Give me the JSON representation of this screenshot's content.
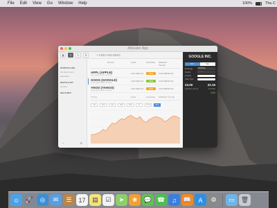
{
  "menubar": {
    "apple": "",
    "items": [
      "File",
      "Edit",
      "View",
      "Go",
      "Window",
      "Help"
    ],
    "battery": "100%",
    "clock": "Thu C"
  },
  "window": {
    "title": "Allocator App",
    "add_label": "+ ADD HOLDING",
    "sidebar": {
      "sections": [
        {
          "head": "PORTFOLIOS",
          "items": [
            "My Retirement",
            "Education"
          ]
        },
        {
          "head": "WATCHLIST",
          "items": [
            "Growth"
          ]
        },
        {
          "head": "SECTORS",
          "items": []
        }
      ],
      "footer": [
        "+",
        "⚙"
      ]
    },
    "table": {
      "headers": [
        "STOCK",
        "GAIN",
        "CHANGE",
        "MARKET VALUE"
      ],
      "rows": [
        {
          "name": "APPL (APPLE)",
          "sub": "Lorem ipsum dolor sit amet",
          "gain": "CAD $300.00",
          "change": "15%",
          "value": "CAD $38000.00",
          "color": "#f5a623"
        },
        {
          "name": "GOOG (GOOGLE)",
          "sub": "Lorem ipsum dolor sit amet",
          "gain": "CAD $300.00",
          "change": "15%",
          "value": "CAD $38000.00",
          "color": "#8cc63f"
        },
        {
          "name": "YHOO (YAHOO)",
          "sub": "Lorem ipsum dolor sit amet",
          "gain": "CAD $300.00",
          "change": "15%",
          "value": "CAD $38000.00",
          "color": "#f5a623"
        }
      ],
      "totals": [
        "TOTAL",
        "GAIN",
        "CHANGE",
        "MARKET VALUE"
      ]
    },
    "ranges": {
      "options": [
        "1D",
        "1W",
        "1M",
        "3M",
        "6M",
        "1Y",
        "YTD",
        "ALL"
      ],
      "selected": "ALL"
    },
    "chart_values": [
      10,
      11,
      12,
      14,
      18,
      16,
      22,
      27,
      26,
      30,
      33,
      32,
      36,
      38,
      35,
      33,
      36,
      30,
      28,
      32,
      34,
      36,
      35,
      33,
      29,
      31,
      35,
      37,
      36,
      33
    ],
    "panel": {
      "title": "GOOGLE INC.",
      "tabs": [
        "BUY",
        "SELL"
      ],
      "tab_selected": "BUY",
      "fields": [
        {
          "label": "Exchange",
          "value": "NASDAQ"
        },
        {
          "label": "Symbol",
          "value": "GOOG"
        },
        {
          "label": "Quantity",
          "value": "—"
        },
        {
          "label": "Order Type",
          "value": "LIMIT"
        }
      ],
      "last_price": "23.00",
      "target_price": "22.15",
      "bottom_left": "MARKET VALUE",
      "bottom_right": "CHANGE",
      "change_value": "23%"
    }
  },
  "dock": {
    "icons": [
      "finder-icon",
      "launchpad-icon",
      "safari-icon",
      "mail-icon",
      "contacts-icon",
      "calendar-icon",
      "notes-icon",
      "reminders-icon",
      "maps-icon",
      "photos-icon",
      "messages-icon",
      "facetime-icon",
      "itunes-icon",
      "ibooks-icon",
      "appstore-icon",
      "preferences-icon",
      "folder-icon",
      "trash-icon"
    ]
  }
}
